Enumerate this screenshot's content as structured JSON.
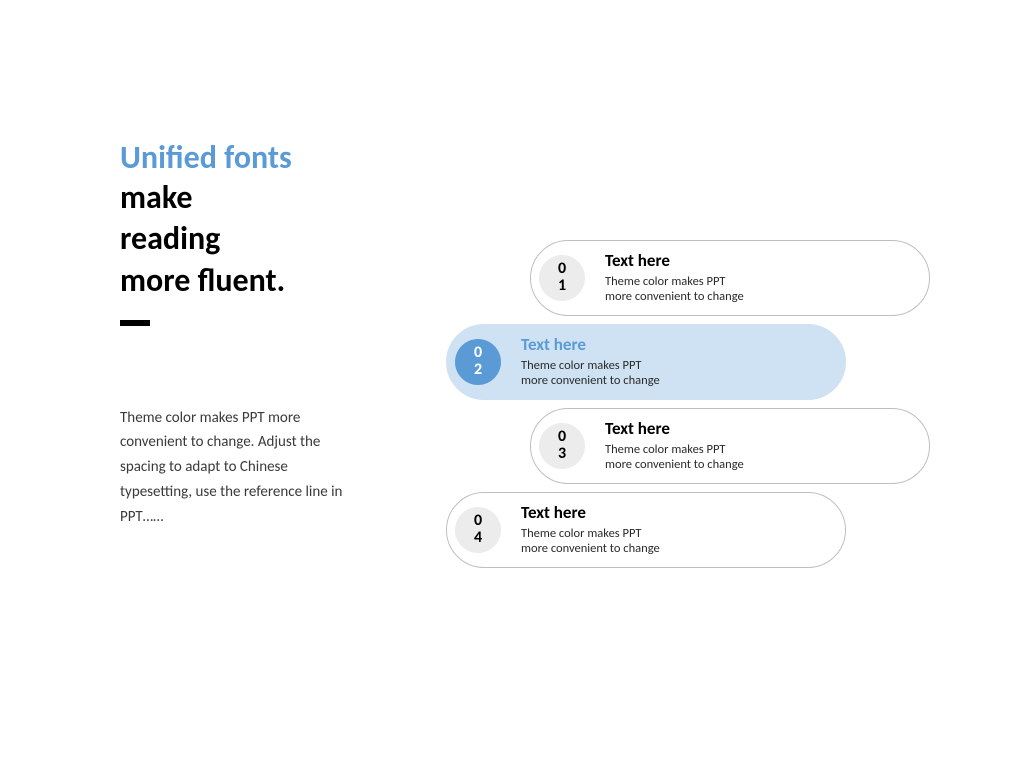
{
  "colors": {
    "accent": "#5b9bd5",
    "pill_active_bg": "#cfe2f3"
  },
  "heading": {
    "accent_line": "Unified fonts",
    "main_line1": "make",
    "main_line2": "reading",
    "main_line3": "more fluent."
  },
  "paragraph": "Theme color makes PPT more convenient to change. Adjust the spacing to adapt to Chinese typesetting, use the reference line in PPT……",
  "items": [
    {
      "num_top": "0",
      "num_bottom": "1",
      "title": "Text here",
      "desc": "Theme color makes PPT more convenient to change",
      "active": false
    },
    {
      "num_top": "0",
      "num_bottom": "2",
      "title": "Text here",
      "desc": "Theme color makes PPT more convenient to change",
      "active": true
    },
    {
      "num_top": "0",
      "num_bottom": "3",
      "title": "Text here",
      "desc": "Theme color makes PPT more convenient to change",
      "active": false
    },
    {
      "num_top": "0",
      "num_bottom": "4",
      "title": "Text here",
      "desc": "Theme color makes PPT more convenient to change",
      "active": false
    }
  ]
}
